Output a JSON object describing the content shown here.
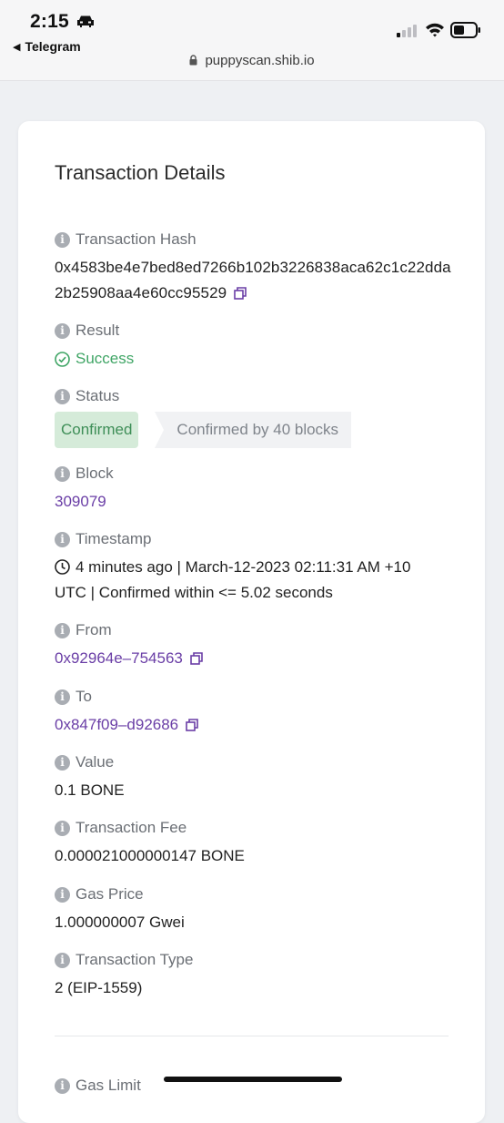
{
  "status_bar": {
    "time": "2:15",
    "back_app": "Telegram"
  },
  "browser": {
    "url": "puppyscan.shib.io"
  },
  "card": {
    "title": "Transaction Details",
    "fields": {
      "hash": {
        "label": "Transaction Hash",
        "value": "0x4583be4e7bed8ed7266b102b3226838aca62c1c22dda2b25908aa4e60cc95529"
      },
      "result": {
        "label": "Result",
        "value": "Success"
      },
      "status": {
        "label": "Status",
        "badge": "Confirmed",
        "detail": "Confirmed by 40 blocks"
      },
      "block": {
        "label": "Block",
        "value": "309079"
      },
      "timestamp": {
        "label": "Timestamp",
        "value": "4 minutes ago | March-12-2023 02:11:31 AM +10 UTC | Confirmed within <= 5.02 seconds"
      },
      "from": {
        "label": "From",
        "value": "0x92964e–754563"
      },
      "to": {
        "label": "To",
        "value": "0x847f09–d92686"
      },
      "value": {
        "label": "Value",
        "value": "0.1 BONE"
      },
      "fee": {
        "label": "Transaction Fee",
        "value": "0.000021000000147 BONE"
      },
      "gas_price": {
        "label": "Gas Price",
        "value": "1.000000007 Gwei"
      },
      "tx_type": {
        "label": "Transaction Type",
        "value": "2 (EIP-1559)"
      },
      "gas_limit": {
        "label": "Gas Limit"
      }
    }
  },
  "colors": {
    "link": "#6a3ea6",
    "success": "#3fa565",
    "confirmed_bg": "#d5ebd9",
    "page_bg": "#eef0f3"
  }
}
